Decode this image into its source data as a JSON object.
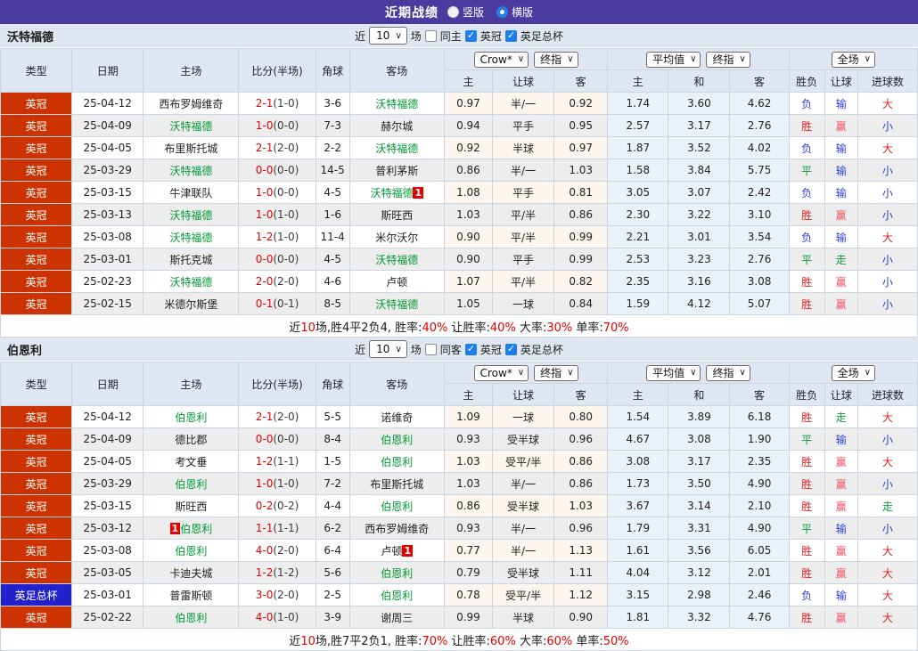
{
  "topbar": {
    "title": "近期战绩",
    "radios": [
      {
        "label": "竖版",
        "checked": false
      },
      {
        "label": "横版",
        "checked": true
      }
    ]
  },
  "colors": {
    "topbar_purple": "#4a3b9f",
    "panel_blue": "#dee7f2",
    "league_championship": "#cc3300",
    "league_facup": "#2222cc",
    "team_highlight_green": "#009933",
    "score_red": "#e60000",
    "win_red": "#e02222",
    "loss_blue": "#2c3ed8",
    "draw_green": "#089b3c",
    "avg_col_bg": "#e8f3f9",
    "odds_col_bg": "#fdf6ee"
  },
  "table_header": {
    "type": "类型",
    "date": "日期",
    "home": "主场",
    "score": "比分(半场)",
    "corner": "角球",
    "away": "客场",
    "odds_group_selects": [
      "Crow*",
      "终指"
    ],
    "avg_group_selects": [
      "平均值",
      "终指"
    ],
    "result_group_selects": [
      "全场"
    ],
    "odds_cols": [
      "主",
      "让球",
      "客"
    ],
    "avg_cols": [
      "主",
      "和",
      "客"
    ],
    "result_cols": [
      "胜负",
      "让球",
      "进球数"
    ]
  },
  "value_color_map": {
    "胜": "v-red",
    "平": "v-green",
    "负": "v-blue",
    "赢": "v-pink",
    "输": "v-blue",
    "走": "v-green",
    "大": "v-red",
    "小": "v-blue"
  },
  "sections": [
    {
      "team": "沃特福德",
      "filter": {
        "prefix": "近",
        "count": "10",
        "suffix": "场",
        "same_label": "同主",
        "same_checked": false,
        "leagues": [
          {
            "label": "英冠",
            "checked": true
          },
          {
            "label": "英足总杯",
            "checked": true
          }
        ]
      },
      "rows": [
        {
          "league": "英冠",
          "league_color": "championship",
          "date": "25-04-12",
          "home": {
            "name": "西布罗姆维奇",
            "highlighted": false
          },
          "score_full": "2-1",
          "score_half": "(1-0)",
          "corners": "3-6",
          "away": {
            "name": "沃特福德",
            "highlighted": true
          },
          "odds_home": "0.97",
          "handicap": "半/一",
          "odds_away": "0.92",
          "avg_home": "1.74",
          "avg_draw": "3.60",
          "avg_away": "4.62",
          "result": "负",
          "handicap_result": "输",
          "goals_result": "大"
        },
        {
          "league": "英冠",
          "league_color": "championship",
          "date": "25-04-09",
          "home": {
            "name": "沃特福德",
            "highlighted": true
          },
          "score_full": "1-0",
          "score_half": "(0-0)",
          "corners": "7-3",
          "away": {
            "name": "赫尔城",
            "highlighted": false
          },
          "odds_home": "0.94",
          "handicap": "平手",
          "odds_away": "0.95",
          "avg_home": "2.57",
          "avg_draw": "3.17",
          "avg_away": "2.76",
          "result": "胜",
          "handicap_result": "赢",
          "goals_result": "小"
        },
        {
          "league": "英冠",
          "league_color": "championship",
          "date": "25-04-05",
          "home": {
            "name": "布里斯托城",
            "highlighted": false
          },
          "score_full": "2-1",
          "score_half": "(2-0)",
          "corners": "2-2",
          "away": {
            "name": "沃特福德",
            "highlighted": true
          },
          "odds_home": "0.92",
          "handicap": "半球",
          "odds_away": "0.97",
          "avg_home": "1.87",
          "avg_draw": "3.52",
          "avg_away": "4.02",
          "result": "负",
          "handicap_result": "输",
          "goals_result": "大"
        },
        {
          "league": "英冠",
          "league_color": "championship",
          "date": "25-03-29",
          "home": {
            "name": "沃特福德",
            "highlighted": true
          },
          "score_full": "0-0",
          "score_half": "(0-0)",
          "corners": "14-5",
          "away": {
            "name": "普利茅斯",
            "highlighted": false
          },
          "odds_home": "0.86",
          "handicap": "半/一",
          "odds_away": "1.03",
          "avg_home": "1.58",
          "avg_draw": "3.84",
          "avg_away": "5.75",
          "result": "平",
          "handicap_result": "输",
          "goals_result": "小"
        },
        {
          "league": "英冠",
          "league_color": "championship",
          "date": "25-03-15",
          "home": {
            "name": "牛津联队",
            "highlighted": false
          },
          "score_full": "1-0",
          "score_half": "(0-0)",
          "corners": "4-5",
          "away": {
            "name": "沃特福德",
            "highlighted": true,
            "badge_after": "1"
          },
          "odds_home": "1.08",
          "handicap": "平手",
          "odds_away": "0.81",
          "avg_home": "3.05",
          "avg_draw": "3.07",
          "avg_away": "2.42",
          "result": "负",
          "handicap_result": "输",
          "goals_result": "小"
        },
        {
          "league": "英冠",
          "league_color": "championship",
          "date": "25-03-13",
          "home": {
            "name": "沃特福德",
            "highlighted": true
          },
          "score_full": "1-0",
          "score_half": "(1-0)",
          "corners": "1-6",
          "away": {
            "name": "斯旺西",
            "highlighted": false
          },
          "odds_home": "1.03",
          "handicap": "平/半",
          "odds_away": "0.86",
          "avg_home": "2.30",
          "avg_draw": "3.22",
          "avg_away": "3.10",
          "result": "胜",
          "handicap_result": "赢",
          "goals_result": "小"
        },
        {
          "league": "英冠",
          "league_color": "championship",
          "date": "25-03-08",
          "home": {
            "name": "沃特福德",
            "highlighted": true
          },
          "score_full": "1-2",
          "score_half": "(1-0)",
          "corners": "11-4",
          "away": {
            "name": "米尔沃尔",
            "highlighted": false
          },
          "odds_home": "0.90",
          "handicap": "平/半",
          "odds_away": "0.99",
          "avg_home": "2.21",
          "avg_draw": "3.01",
          "avg_away": "3.54",
          "result": "负",
          "handicap_result": "输",
          "goals_result": "大"
        },
        {
          "league": "英冠",
          "league_color": "championship",
          "date": "25-03-01",
          "home": {
            "name": "斯托克城",
            "highlighted": false
          },
          "score_full": "0-0",
          "score_half": "(0-0)",
          "corners": "4-5",
          "away": {
            "name": "沃特福德",
            "highlighted": true
          },
          "odds_home": "0.90",
          "handicap": "平手",
          "odds_away": "0.99",
          "avg_home": "2.53",
          "avg_draw": "3.23",
          "avg_away": "2.76",
          "result": "平",
          "handicap_result": "走",
          "goals_result": "小"
        },
        {
          "league": "英冠",
          "league_color": "championship",
          "date": "25-02-23",
          "home": {
            "name": "沃特福德",
            "highlighted": true
          },
          "score_full": "2-0",
          "score_half": "(2-0)",
          "corners": "4-6",
          "away": {
            "name": "卢顿",
            "highlighted": false
          },
          "odds_home": "1.07",
          "handicap": "平/半",
          "odds_away": "0.82",
          "avg_home": "2.35",
          "avg_draw": "3.16",
          "avg_away": "3.08",
          "result": "胜",
          "handicap_result": "赢",
          "goals_result": "小"
        },
        {
          "league": "英冠",
          "league_color": "championship",
          "date": "25-02-15",
          "home": {
            "name": "米德尔斯堡",
            "highlighted": false
          },
          "score_full": "0-1",
          "score_half": "(0-1)",
          "corners": "8-5",
          "away": {
            "name": "沃特福德",
            "highlighted": true
          },
          "odds_home": "1.05",
          "handicap": "一球",
          "odds_away": "0.84",
          "avg_home": "1.59",
          "avg_draw": "4.12",
          "avg_away": "5.07",
          "result": "胜",
          "handicap_result": "赢",
          "goals_result": "小"
        }
      ],
      "summary_parts": [
        {
          "text": "近",
          "color": "k"
        },
        {
          "text": "10",
          "color": "r"
        },
        {
          "text": "场,胜4平2负4, 胜率:",
          "color": "k"
        },
        {
          "text": "40%",
          "color": "r"
        },
        {
          "text": " 让胜率:",
          "color": "k"
        },
        {
          "text": "40%",
          "color": "r"
        },
        {
          "text": " 大率:",
          "color": "k"
        },
        {
          "text": "30%",
          "color": "r"
        },
        {
          "text": " 单率:",
          "color": "k"
        },
        {
          "text": "70%",
          "color": "r"
        }
      ]
    },
    {
      "team": "伯恩利",
      "filter": {
        "prefix": "近",
        "count": "10",
        "suffix": "场",
        "same_label": "同客",
        "same_checked": false,
        "leagues": [
          {
            "label": "英冠",
            "checked": true
          },
          {
            "label": "英足总杯",
            "checked": true
          }
        ]
      },
      "rows": [
        {
          "league": "英冠",
          "league_color": "championship",
          "date": "25-04-12",
          "home": {
            "name": "伯恩利",
            "highlighted": true
          },
          "score_full": "2-1",
          "score_half": "(2-0)",
          "corners": "5-5",
          "away": {
            "name": "诺维奇",
            "highlighted": false
          },
          "odds_home": "1.09",
          "handicap": "一球",
          "odds_away": "0.80",
          "avg_home": "1.54",
          "avg_draw": "3.89",
          "avg_away": "6.18",
          "result": "胜",
          "handicap_result": "走",
          "goals_result": "大"
        },
        {
          "league": "英冠",
          "league_color": "championship",
          "date": "25-04-09",
          "home": {
            "name": "德比郡",
            "highlighted": false
          },
          "score_full": "0-0",
          "score_half": "(0-0)",
          "corners": "8-4",
          "away": {
            "name": "伯恩利",
            "highlighted": true
          },
          "odds_home": "0.93",
          "handicap": "受半球",
          "odds_away": "0.96",
          "avg_home": "4.67",
          "avg_draw": "3.08",
          "avg_away": "1.90",
          "result": "平",
          "handicap_result": "输",
          "goals_result": "小"
        },
        {
          "league": "英冠",
          "league_color": "championship",
          "date": "25-04-05",
          "home": {
            "name": "考文垂",
            "highlighted": false
          },
          "score_full": "1-2",
          "score_half": "(1-1)",
          "corners": "1-5",
          "away": {
            "name": "伯恩利",
            "highlighted": true
          },
          "odds_home": "1.03",
          "handicap": "受平/半",
          "odds_away": "0.86",
          "avg_home": "3.08",
          "avg_draw": "3.17",
          "avg_away": "2.35",
          "result": "胜",
          "handicap_result": "赢",
          "goals_result": "大"
        },
        {
          "league": "英冠",
          "league_color": "championship",
          "date": "25-03-29",
          "home": {
            "name": "伯恩利",
            "highlighted": true
          },
          "score_full": "1-0",
          "score_half": "(1-0)",
          "corners": "7-2",
          "away": {
            "name": "布里斯托城",
            "highlighted": false
          },
          "odds_home": "1.03",
          "handicap": "半/一",
          "odds_away": "0.86",
          "avg_home": "1.73",
          "avg_draw": "3.50",
          "avg_away": "4.90",
          "result": "胜",
          "handicap_result": "赢",
          "goals_result": "小"
        },
        {
          "league": "英冠",
          "league_color": "championship",
          "date": "25-03-15",
          "home": {
            "name": "斯旺西",
            "highlighted": false
          },
          "score_full": "0-2",
          "score_half": "(0-2)",
          "corners": "4-4",
          "away": {
            "name": "伯恩利",
            "highlighted": true
          },
          "odds_home": "0.86",
          "handicap": "受半球",
          "odds_away": "1.03",
          "avg_home": "3.67",
          "avg_draw": "3.14",
          "avg_away": "2.10",
          "result": "胜",
          "handicap_result": "赢",
          "goals_result": "走"
        },
        {
          "league": "英冠",
          "league_color": "championship",
          "date": "25-03-12",
          "home": {
            "name": "伯恩利",
            "highlighted": true,
            "badge_before": "1"
          },
          "score_full": "1-1",
          "score_half": "(1-1)",
          "corners": "6-2",
          "away": {
            "name": "西布罗姆维奇",
            "highlighted": false
          },
          "odds_home": "0.93",
          "handicap": "半/一",
          "odds_away": "0.96",
          "avg_home": "1.79",
          "avg_draw": "3.31",
          "avg_away": "4.90",
          "result": "平",
          "handicap_result": "输",
          "goals_result": "小"
        },
        {
          "league": "英冠",
          "league_color": "championship",
          "date": "25-03-08",
          "home": {
            "name": "伯恩利",
            "highlighted": true
          },
          "score_full": "4-0",
          "score_half": "(2-0)",
          "corners": "6-4",
          "away": {
            "name": "卢顿",
            "highlighted": false,
            "badge_after": "1"
          },
          "odds_home": "0.77",
          "handicap": "半/一",
          "odds_away": "1.13",
          "avg_home": "1.61",
          "avg_draw": "3.56",
          "avg_away": "6.05",
          "result": "胜",
          "handicap_result": "赢",
          "goals_result": "大"
        },
        {
          "league": "英冠",
          "league_color": "championship",
          "date": "25-03-05",
          "home": {
            "name": "卡迪夫城",
            "highlighted": false
          },
          "score_full": "1-2",
          "score_half": "(1-2)",
          "corners": "5-6",
          "away": {
            "name": "伯恩利",
            "highlighted": true
          },
          "odds_home": "0.79",
          "handicap": "受半球",
          "odds_away": "1.11",
          "avg_home": "4.04",
          "avg_draw": "3.12",
          "avg_away": "2.01",
          "result": "胜",
          "handicap_result": "赢",
          "goals_result": "大"
        },
        {
          "league": "英足总杯",
          "league_color": "facup",
          "date": "25-03-01",
          "home": {
            "name": "普雷斯顿",
            "highlighted": false
          },
          "score_full": "3-0",
          "score_half": "(2-0)",
          "corners": "2-5",
          "away": {
            "name": "伯恩利",
            "highlighted": true
          },
          "odds_home": "0.78",
          "handicap": "受平/半",
          "odds_away": "1.12",
          "avg_home": "3.15",
          "avg_draw": "2.98",
          "avg_away": "2.46",
          "result": "负",
          "handicap_result": "输",
          "goals_result": "大"
        },
        {
          "league": "英冠",
          "league_color": "championship",
          "date": "25-02-22",
          "home": {
            "name": "伯恩利",
            "highlighted": true
          },
          "score_full": "4-0",
          "score_half": "(1-0)",
          "corners": "3-9",
          "away": {
            "name": "谢周三",
            "highlighted": false
          },
          "odds_home": "0.99",
          "handicap": "半球",
          "odds_away": "0.90",
          "avg_home": "1.81",
          "avg_draw": "3.32",
          "avg_away": "4.76",
          "result": "胜",
          "handicap_result": "赢",
          "goals_result": "大"
        }
      ],
      "summary_parts": [
        {
          "text": "近",
          "color": "k"
        },
        {
          "text": "10",
          "color": "r"
        },
        {
          "text": "场,胜7平2负1, 胜率:",
          "color": "k"
        },
        {
          "text": "70%",
          "color": "r"
        },
        {
          "text": " 让胜率:",
          "color": "k"
        },
        {
          "text": "60%",
          "color": "r"
        },
        {
          "text": " 大率:",
          "color": "k"
        },
        {
          "text": "60%",
          "color": "r"
        },
        {
          "text": " 单率:",
          "color": "k"
        },
        {
          "text": "50%",
          "color": "r"
        }
      ]
    }
  ]
}
